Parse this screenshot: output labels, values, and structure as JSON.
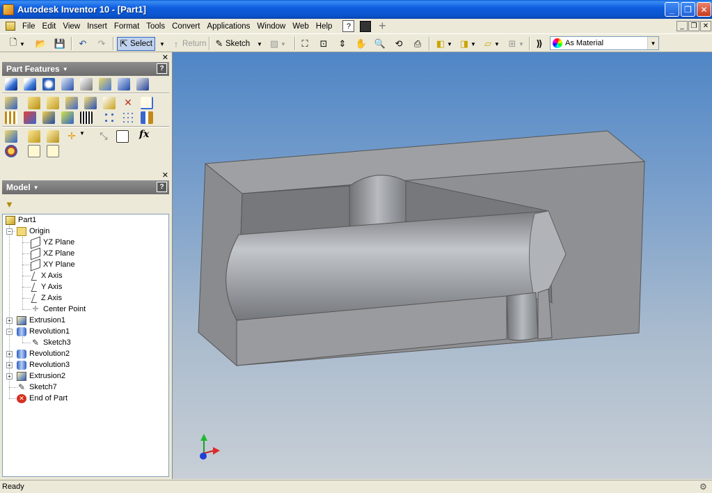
{
  "window": {
    "title": "Autodesk Inventor 10 - [Part1]"
  },
  "menu": [
    "File",
    "Edit",
    "View",
    "Insert",
    "Format",
    "Tools",
    "Convert",
    "Applications",
    "Window",
    "Web",
    "Help"
  ],
  "toolbar": {
    "select_label": "Select",
    "return_label": "Return",
    "sketch_label": "Sketch",
    "material_value": "As Material"
  },
  "part_features_panel": {
    "title": "Part Features"
  },
  "model_panel": {
    "title": "Model"
  },
  "browser_tree": {
    "root": "Part1",
    "origin": "Origin",
    "origin_children": [
      "YZ Plane",
      "XZ Plane",
      "XY Plane",
      "X Axis",
      "Y Axis",
      "Z Axis",
      "Center Point"
    ],
    "features": [
      "Extrusion1",
      "Revolution1",
      "Sketch3",
      "Revolution2",
      "Revolution3",
      "Extrusion2",
      "Sketch7",
      "End of Part"
    ]
  },
  "status": {
    "text": "Ready"
  },
  "colors": {
    "title_bar": "#0a52c9",
    "viewport_top": "#4f86c6",
    "viewport_bottom": "#c8cfd6",
    "panel_header": "#7a7a7a"
  }
}
